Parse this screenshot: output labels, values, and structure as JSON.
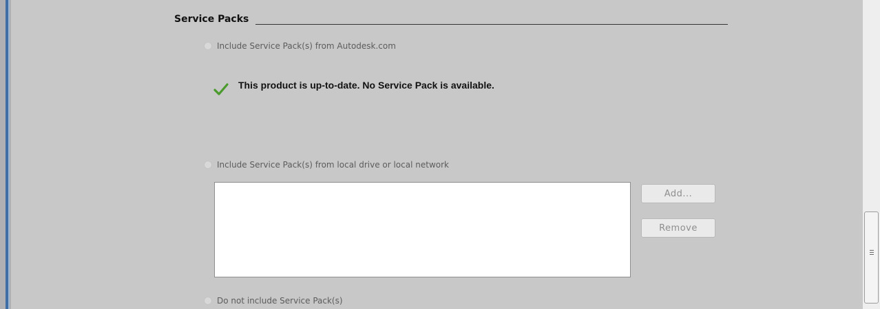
{
  "section": {
    "title": "Service Packs"
  },
  "options": {
    "include_autodesk": "Include Service Pack(s) from Autodesk.com",
    "include_local": "Include Service Pack(s) from local drive or local network",
    "do_not_include": "Do not include Service Pack(s)"
  },
  "status": {
    "message": "This product is up-to-date. No Service Pack is available.",
    "icon": "checkmark-icon",
    "icon_color": "#4a9a2c"
  },
  "buttons": {
    "add": "Add...",
    "remove": "Remove"
  },
  "colors": {
    "panel_background": "#c8c8c9",
    "accent_strip": "#3f6ea6",
    "listbox_background": "#ffffff"
  }
}
